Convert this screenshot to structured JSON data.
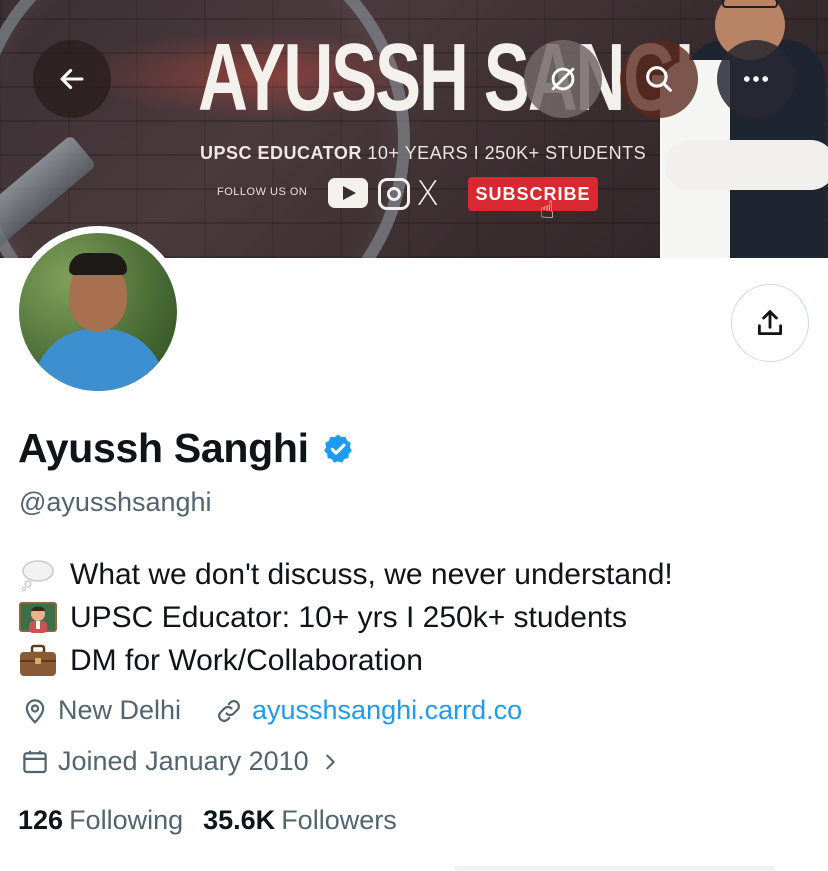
{
  "banner": {
    "title": "AYUSSH SANGHI",
    "subtitle_bold": "UPSC EDUCATOR",
    "subtitle_rest": " 10+ YEARS I 250K+ STUDENTS",
    "follow_us": "FOLLOW US ON",
    "subscribe": "SUBSCRIBE",
    "x_logo": "X"
  },
  "toolbar": {
    "back_icon": "back-arrow-icon",
    "translate_icon": "translate-off-icon",
    "search_icon": "search-icon",
    "more_icon": "more-icon"
  },
  "profile": {
    "name": "Ayussh Sanghi",
    "handle": "@ayusshsanghi",
    "verified": true,
    "accent": "#1d9bf0",
    "bio": [
      {
        "emoji": "thought-balloon",
        "text": "What we don't discuss, we never understand!"
      },
      {
        "emoji": "teacher",
        "text": "UPSC Educator: 10+ yrs I 250k+ students"
      },
      {
        "emoji": "briefcase",
        "text": "DM for Work/Collaboration"
      }
    ],
    "location": "New Delhi",
    "website": "ayusshsanghi.carrd.co",
    "joined": "Joined January 2010"
  },
  "stats": {
    "following_count": "126",
    "following_label": "Following",
    "followers_count": "35.6K",
    "followers_label": "Followers"
  }
}
